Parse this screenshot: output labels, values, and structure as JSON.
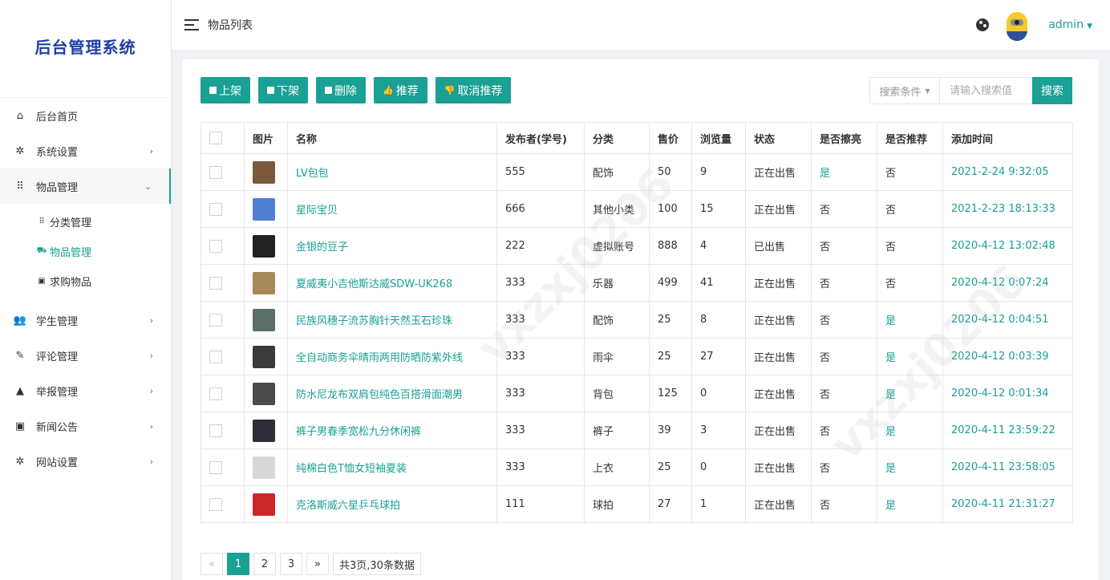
{
  "app": {
    "brand": "后台管理系统"
  },
  "header": {
    "title": "物品列表",
    "user": "admin"
  },
  "sidebar": {
    "items": [
      {
        "label": "后台首页",
        "icon": "home-icon",
        "glyph": "⌂",
        "arrow": ""
      },
      {
        "label": "系统设置",
        "icon": "gear-icon",
        "glyph": "✲",
        "arrow": "›"
      },
      {
        "label": "物品管理",
        "icon": "grid-icon",
        "glyph": "⠿",
        "arrow": "⌄"
      },
      {
        "label": "学生管理",
        "icon": "users-icon",
        "glyph": "👥",
        "arrow": "›"
      },
      {
        "label": "评论管理",
        "icon": "comment-icon",
        "glyph": "✎",
        "arrow": "›"
      },
      {
        "label": "举报管理",
        "icon": "warning-icon",
        "glyph": "▲",
        "arrow": "›"
      },
      {
        "label": "新闻公告",
        "icon": "news-icon",
        "glyph": "▣",
        "arrow": "›"
      },
      {
        "label": "网站设置",
        "icon": "settings-icon",
        "glyph": "✲",
        "arrow": "›"
      }
    ],
    "submenu": [
      {
        "label": "分类管理",
        "icon": "category-icon",
        "glyph": "⠿"
      },
      {
        "label": "物品管理",
        "icon": "cart-icon",
        "glyph": "⛟"
      },
      {
        "label": "求购物品",
        "icon": "request-icon",
        "glyph": "▣"
      }
    ]
  },
  "toolbar": {
    "shelf_on": "上架",
    "shelf_off": "下架",
    "delete": "删除",
    "recommend": "推荐",
    "unrecommend": "取消推荐"
  },
  "search": {
    "condition": "搜索条件",
    "placeholder": "请输入搜索值",
    "button": "搜索"
  },
  "table": {
    "columns": [
      "图片",
      "名称",
      "发布者(学号)",
      "分类",
      "售价",
      "浏览量",
      "状态",
      "是否擦亮",
      "是否推荐",
      "添加时间"
    ],
    "rows": [
      {
        "name": "LV包包",
        "publisher": "555",
        "category": "配饰",
        "price": "50",
        "views": "9",
        "status": "正在出售",
        "polished": "是",
        "recommended": "否",
        "time": "2021-2-24 9:32:05",
        "thumb": "#7a5a3a"
      },
      {
        "name": "星际宝贝",
        "publisher": "666",
        "category": "其他小类",
        "price": "100",
        "views": "15",
        "status": "正在出售",
        "polished": "否",
        "recommended": "否",
        "time": "2021-2-23 18:13:33",
        "thumb": "#4f7fd0"
      },
      {
        "name": "金银的豆子",
        "publisher": "222",
        "category": "虚拟账号",
        "price": "888",
        "views": "4",
        "status": "已出售",
        "polished": "否",
        "recommended": "否",
        "time": "2020-4-12 13:02:48",
        "thumb": "#222222"
      },
      {
        "name": "夏威夷小吉他斯达威SDW-UK268",
        "publisher": "333",
        "category": "乐器",
        "price": "499",
        "views": "41",
        "status": "正在出售",
        "polished": "否",
        "recommended": "否",
        "time": "2020-4-12 0:07:24",
        "thumb": "#a88a5a"
      },
      {
        "name": "民族风穗子流苏胸针天然玉石珍珠",
        "publisher": "333",
        "category": "配饰",
        "price": "25",
        "views": "8",
        "status": "正在出售",
        "polished": "否",
        "recommended": "是",
        "time": "2020-4-12 0:04:51",
        "thumb": "#5a6e6a"
      },
      {
        "name": "全自动商务伞晴雨两用防晒防紫外线",
        "publisher": "333",
        "category": "雨伞",
        "price": "25",
        "views": "27",
        "status": "正在出售",
        "polished": "否",
        "recommended": "是",
        "time": "2020-4-12 0:03:39",
        "thumb": "#3a3a3a"
      },
      {
        "name": "防水尼龙布双肩包纯色百搭滑面潮男",
        "publisher": "333",
        "category": "背包",
        "price": "125",
        "views": "0",
        "status": "正在出售",
        "polished": "否",
        "recommended": "是",
        "time": "2020-4-12 0:01:34",
        "thumb": "#4a4a4a"
      },
      {
        "name": "裤子男春季宽松九分休闲裤",
        "publisher": "333",
        "category": "裤子",
        "price": "39",
        "views": "3",
        "status": "正在出售",
        "polished": "否",
        "recommended": "是",
        "time": "2020-4-11 23:59:22",
        "thumb": "#2e2e38"
      },
      {
        "name": "纯棉白色T恤女短袖夏装",
        "publisher": "333",
        "category": "上衣",
        "price": "25",
        "views": "0",
        "status": "正在出售",
        "polished": "否",
        "recommended": "是",
        "time": "2020-4-11 23:58:05",
        "thumb": "#d8d8d8"
      },
      {
        "name": "克洛斯威六星乒乓球拍",
        "publisher": "111",
        "category": "球拍",
        "price": "27",
        "views": "1",
        "status": "正在出售",
        "polished": "否",
        "recommended": "是",
        "time": "2020-4-11 21:31:27",
        "thumb": "#c8282a"
      }
    ]
  },
  "pagination": {
    "prev": "«",
    "pages": [
      "1",
      "2",
      "3"
    ],
    "current": "1",
    "next": "»",
    "info": "共3页,30条数据"
  },
  "colors": {
    "accent": "#1aa094",
    "brand": "#1e3fa3"
  }
}
